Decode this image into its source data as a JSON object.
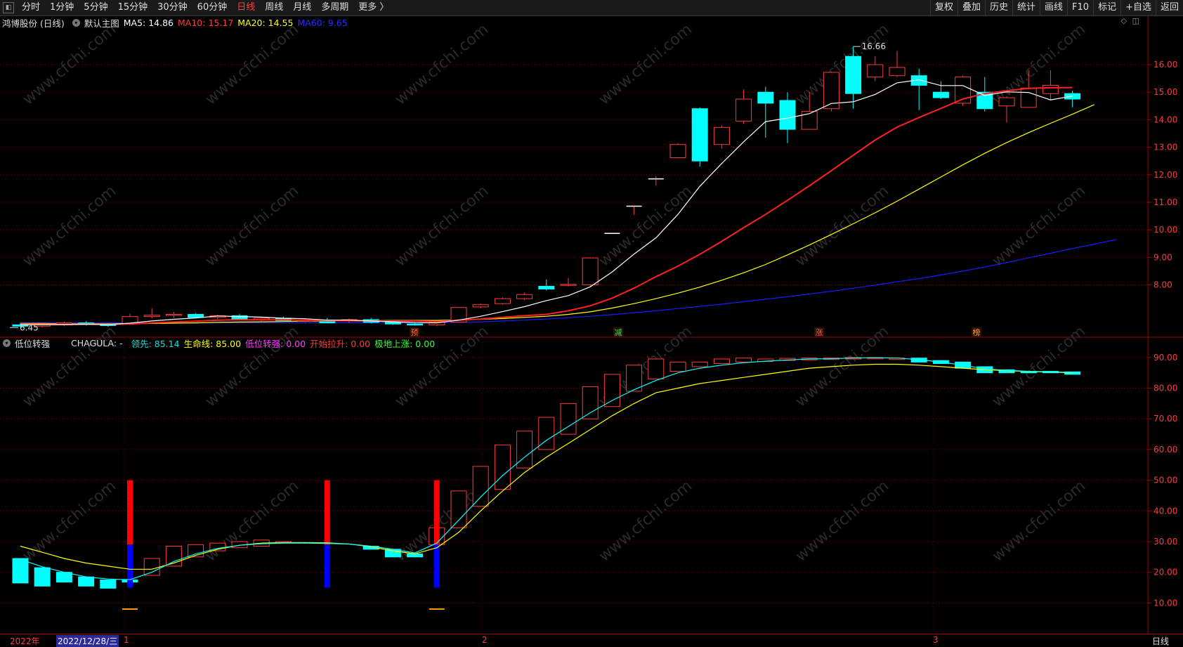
{
  "toolbar": {
    "collapse_glyph": "◧",
    "periods": [
      "分时",
      "1分钟",
      "5分钟",
      "15分钟",
      "30分钟",
      "60分钟",
      "日线",
      "周线",
      "月线",
      "多周期",
      "更多 〉"
    ],
    "active_period_index": 6,
    "right_buttons": [
      "复权",
      "叠加",
      "历史",
      "统计",
      "画线",
      "F10",
      "标记",
      "+自选",
      "返回"
    ]
  },
  "main_info": {
    "stock": "鸿博股份 (日线)",
    "template": "默认主图",
    "ma5": "MA5: 14.86",
    "ma10": "MA10: 15.17",
    "ma20": "MA20: 14.55",
    "ma60": "MA60: 9.65"
  },
  "sub_info": {
    "indicator": "低位转强",
    "formula": "CHAGULA: -",
    "lead": "领先: 85.14",
    "life": "生命线: 85.00",
    "low_strong": "低位转强: 0.00",
    "start_up": "开始拉升: 0.00",
    "bottom_rise": "极地上涨: 0.00"
  },
  "annotations": {
    "high_label": "16.66",
    "low_label": "6.45"
  },
  "markers": [
    {
      "label": "预",
      "color": "#ff6a3a"
    },
    {
      "label": "减",
      "color": "#2fdc5a"
    },
    {
      "label": "涨",
      "color": "#ff5555"
    },
    {
      "label": "榜",
      "color": "#ff9a3a"
    }
  ],
  "price_axis": {
    "ticks": [
      "16.00",
      "15.00",
      "14.00",
      "13.00",
      "12.00",
      "11.00",
      "10.00",
      "9.00",
      "8.00"
    ]
  },
  "sub_axis": {
    "ticks": [
      "90.00",
      "80.00",
      "70.00",
      "60.00",
      "50.00",
      "40.00",
      "30.00",
      "20.00",
      "10.00"
    ]
  },
  "bottom": {
    "year": "2022年",
    "date": "2022/12/28/三",
    "m1": "1",
    "m2": "2",
    "m3": "3",
    "period": "日线"
  },
  "colors": {
    "up": "#ff3b3b",
    "down": "#00ffff",
    "ma5": "#ffffff",
    "ma10": "#ff2020",
    "ma20": "#ffff00",
    "ma60": "#1a1aff",
    "lead": "#00ffff",
    "life": "#ffff00",
    "grid": "#6a0000"
  },
  "chart_data": {
    "type": "candlestick",
    "candles": [
      {
        "o": 6.55,
        "h": 6.62,
        "l": 6.48,
        "c": 6.5
      },
      {
        "o": 6.5,
        "h": 6.58,
        "l": 6.45,
        "c": 6.55
      },
      {
        "o": 6.55,
        "h": 6.66,
        "l": 6.5,
        "c": 6.62
      },
      {
        "o": 6.62,
        "h": 6.68,
        "l": 6.52,
        "c": 6.56
      },
      {
        "o": 6.56,
        "h": 6.62,
        "l": 6.48,
        "c": 6.52
      },
      {
        "o": 6.6,
        "h": 6.95,
        "l": 6.55,
        "c": 6.85
      },
      {
        "o": 6.85,
        "h": 7.15,
        "l": 6.78,
        "c": 6.9
      },
      {
        "o": 6.9,
        "h": 7.02,
        "l": 6.8,
        "c": 6.93
      },
      {
        "o": 6.93,
        "h": 6.98,
        "l": 6.8,
        "c": 6.82
      },
      {
        "o": 6.82,
        "h": 6.92,
        "l": 6.76,
        "c": 6.88
      },
      {
        "o": 6.88,
        "h": 6.94,
        "l": 6.72,
        "c": 6.74
      },
      {
        "o": 6.74,
        "h": 6.82,
        "l": 6.66,
        "c": 6.79
      },
      {
        "o": 6.79,
        "h": 6.85,
        "l": 6.67,
        "c": 6.7
      },
      {
        "o": 6.7,
        "h": 6.78,
        "l": 6.64,
        "c": 6.72
      },
      {
        "o": 6.72,
        "h": 6.8,
        "l": 6.6,
        "c": 6.62
      },
      {
        "o": 6.7,
        "h": 6.78,
        "l": 6.62,
        "c": 6.74
      },
      {
        "o": 6.74,
        "h": 6.8,
        "l": 6.6,
        "c": 6.64
      },
      {
        "o": 6.64,
        "h": 6.7,
        "l": 6.55,
        "c": 6.58
      },
      {
        "o": 6.58,
        "h": 6.64,
        "l": 6.52,
        "c": 6.55
      },
      {
        "o": 6.55,
        "h": 6.7,
        "l": 6.5,
        "c": 6.64
      },
      {
        "o": 6.65,
        "h": 7.2,
        "l": 6.65,
        "c": 7.18
      },
      {
        "o": 7.2,
        "h": 7.32,
        "l": 7.15,
        "c": 7.28
      },
      {
        "o": 7.32,
        "h": 7.55,
        "l": 7.28,
        "c": 7.5
      },
      {
        "o": 7.5,
        "h": 7.72,
        "l": 7.45,
        "c": 7.65
      },
      {
        "o": 7.95,
        "h": 8.2,
        "l": 7.8,
        "c": 7.85
      },
      {
        "o": 8.0,
        "h": 8.25,
        "l": 7.95,
        "c": 8.02
      },
      {
        "o": 8.0,
        "h": 9.0,
        "l": 7.95,
        "c": 8.98
      },
      {
        "o": 9.87,
        "h": 9.87,
        "l": 9.87,
        "c": 9.87
      },
      {
        "o": 10.86,
        "h": 10.86,
        "l": 10.55,
        "c": 10.86
      },
      {
        "o": 11.85,
        "h": 11.95,
        "l": 11.6,
        "c": 11.85
      },
      {
        "o": 12.62,
        "h": 13.15,
        "l": 12.62,
        "c": 13.1
      },
      {
        "o": 14.4,
        "h": 14.45,
        "l": 12.3,
        "c": 12.5
      },
      {
        "o": 13.1,
        "h": 13.8,
        "l": 12.95,
        "c": 13.72
      },
      {
        "o": 13.95,
        "h": 15.1,
        "l": 13.85,
        "c": 14.75
      },
      {
        "o": 15.0,
        "h": 15.2,
        "l": 13.35,
        "c": 14.6
      },
      {
        "o": 14.7,
        "h": 15.0,
        "l": 13.15,
        "c": 13.65
      },
      {
        "o": 13.65,
        "h": 15.0,
        "l": 13.65,
        "c": 14.3
      },
      {
        "o": 14.4,
        "h": 15.75,
        "l": 14.3,
        "c": 15.72
      },
      {
        "o": 16.3,
        "h": 16.66,
        "l": 14.4,
        "c": 14.95
      },
      {
        "o": 15.55,
        "h": 16.3,
        "l": 15.4,
        "c": 16.0
      },
      {
        "o": 15.6,
        "h": 16.5,
        "l": 15.55,
        "c": 15.9
      },
      {
        "o": 15.6,
        "h": 15.85,
        "l": 14.35,
        "c": 15.25
      },
      {
        "o": 15.0,
        "h": 15.4,
        "l": 14.75,
        "c": 14.8
      },
      {
        "o": 14.6,
        "h": 15.6,
        "l": 14.5,
        "c": 15.55
      },
      {
        "o": 15.0,
        "h": 15.55,
        "l": 14.3,
        "c": 14.4
      },
      {
        "o": 14.5,
        "h": 14.85,
        "l": 13.9,
        "c": 14.8
      },
      {
        "o": 14.45,
        "h": 15.8,
        "l": 14.45,
        "c": 15.15
      },
      {
        "o": 14.95,
        "h": 15.8,
        "l": 14.7,
        "c": 15.25
      },
      {
        "o": 14.95,
        "h": 15.05,
        "l": 14.45,
        "c": 14.75
      }
    ],
    "ma5": [
      6.56,
      6.55,
      6.56,
      6.57,
      6.56,
      6.61,
      6.69,
      6.75,
      6.8,
      6.87,
      6.85,
      6.83,
      6.79,
      6.77,
      6.72,
      6.72,
      6.69,
      6.66,
      6.63,
      6.62,
      6.72,
      6.86,
      7.03,
      7.21,
      7.43,
      7.61,
      7.93,
      8.47,
      9.12,
      9.71,
      10.56,
      11.58,
      12.41,
      13.2,
      13.93,
      14.06,
      14.22,
      14.59,
      14.65,
      14.92,
      15.34,
      15.45,
      15.24,
      15.24,
      14.88,
      15.01,
      14.99,
      14.72,
      14.86
    ],
    "ma10": [
      6.58,
      6.57,
      6.57,
      6.57,
      6.57,
      6.58,
      6.62,
      6.65,
      6.68,
      6.72,
      6.73,
      6.73,
      6.73,
      6.72,
      6.7,
      6.7,
      6.69,
      6.69,
      6.69,
      6.67,
      6.72,
      6.76,
      6.82,
      6.88,
      6.93,
      7.06,
      7.24,
      7.52,
      7.88,
      8.3,
      8.68,
      9.11,
      9.58,
      10.08,
      10.56,
      11.07,
      11.6,
      12.15,
      12.71,
      13.26,
      13.73,
      14.08,
      14.41,
      14.75,
      14.95,
      15.05,
      15.14,
      15.16,
      15.17
    ],
    "ma20": [
      6.6,
      6.6,
      6.59,
      6.59,
      6.59,
      6.59,
      6.6,
      6.61,
      6.62,
      6.64,
      6.65,
      6.66,
      6.67,
      6.68,
      6.69,
      6.7,
      6.7,
      6.71,
      6.71,
      6.71,
      6.73,
      6.75,
      6.78,
      6.82,
      6.86,
      6.93,
      7.02,
      7.16,
      7.32,
      7.5,
      7.7,
      7.92,
      8.17,
      8.44,
      8.74,
      9.09,
      9.45,
      9.83,
      10.22,
      10.62,
      11.04,
      11.48,
      11.92,
      12.36,
      12.78,
      13.17,
      13.53,
      13.87,
      14.2,
      14.55
    ],
    "ma60": [
      6.62,
      6.62,
      6.62,
      6.62,
      6.62,
      6.62,
      6.62,
      6.62,
      6.62,
      6.62,
      6.62,
      6.62,
      6.62,
      6.62,
      6.62,
      6.62,
      6.62,
      6.62,
      6.62,
      6.62,
      6.64,
      6.66,
      6.69,
      6.72,
      6.76,
      6.81,
      6.86,
      6.92,
      6.99,
      7.06,
      7.14,
      7.22,
      7.3,
      7.39,
      7.48,
      7.57,
      7.67,
      7.77,
      7.88,
      7.99,
      8.11,
      8.23,
      8.36,
      8.5,
      8.65,
      8.81,
      8.98,
      9.15,
      9.32,
      9.48,
      9.65
    ],
    "y_range": [
      6.1,
      17.2
    ],
    "sub": {
      "y_range": [
        0,
        95
      ],
      "boxes": [
        {
          "i": 0,
          "a": 24.5,
          "b": 16.5,
          "up": false
        },
        {
          "i": 1,
          "a": 21.5,
          "b": 15.5,
          "up": false
        },
        {
          "i": 2,
          "a": 20.0,
          "b": 16.8,
          "up": false
        },
        {
          "i": 3,
          "a": 18.5,
          "b": 15.5,
          "up": false
        },
        {
          "i": 4,
          "a": 17.5,
          "b": 14.8,
          "up": false
        },
        {
          "i": 5,
          "a": 17.5,
          "b": 16.8,
          "up": false
        },
        {
          "i": 6,
          "a": 19.0,
          "b": 24.5,
          "up": true
        },
        {
          "i": 7,
          "a": 22.0,
          "b": 28.5,
          "up": true
        },
        {
          "i": 8,
          "a": 25.0,
          "b": 29.0,
          "up": true
        },
        {
          "i": 9,
          "a": 27.0,
          "b": 29.5,
          "up": true
        },
        {
          "i": 10,
          "a": 28.0,
          "b": 30.0,
          "up": true
        },
        {
          "i": 11,
          "a": 28.5,
          "b": 30.5,
          "up": true
        },
        {
          "i": 12,
          "a": 29.5,
          "b": 30.0,
          "up": true
        },
        {
          "i": 16,
          "a": 28.5,
          "b": 27.5,
          "up": false
        },
        {
          "i": 17,
          "a": 27.5,
          "b": 25.0,
          "up": false
        },
        {
          "i": 18,
          "a": 26.0,
          "b": 25.0,
          "up": false
        },
        {
          "i": 19,
          "a": 29.0,
          "b": 34.5,
          "up": true
        },
        {
          "i": 20,
          "a": 34.5,
          "b": 46.5,
          "up": true
        },
        {
          "i": 21,
          "a": 41.5,
          "b": 54.5,
          "up": true
        },
        {
          "i": 22,
          "a": 47.0,
          "b": 61.5,
          "up": true
        },
        {
          "i": 23,
          "a": 54.0,
          "b": 66.0,
          "up": true
        },
        {
          "i": 24,
          "a": 60.0,
          "b": 70.5,
          "up": true
        },
        {
          "i": 25,
          "a": 65.0,
          "b": 75.0,
          "up": true
        },
        {
          "i": 26,
          "a": 70.0,
          "b": 80.5,
          "up": true
        },
        {
          "i": 27,
          "a": 74.0,
          "b": 84.5,
          "up": true
        },
        {
          "i": 28,
          "a": 79.0,
          "b": 87.5,
          "up": true
        },
        {
          "i": 29,
          "a": 83.0,
          "b": 89.5,
          "up": true
        },
        {
          "i": 30,
          "a": 85.5,
          "b": 88.5,
          "up": true
        },
        {
          "i": 31,
          "a": 87.0,
          "b": 88.5,
          "up": true
        },
        {
          "i": 32,
          "a": 88.0,
          "b": 89.5,
          "up": true
        },
        {
          "i": 33,
          "a": 88.5,
          "b": 89.8,
          "up": true
        },
        {
          "i": 34,
          "a": 88.7,
          "b": 89.5,
          "up": true
        },
        {
          "i": 35,
          "a": 89.0,
          "b": 89.7,
          "up": true
        },
        {
          "i": 36,
          "a": 89.2,
          "b": 89.8,
          "up": true
        },
        {
          "i": 37,
          "a": 89.4,
          "b": 89.8,
          "up": true
        },
        {
          "i": 38,
          "a": 89.5,
          "b": 90.0,
          "up": true
        },
        {
          "i": 39,
          "a": 89.7,
          "b": 90.0,
          "up": true
        },
        {
          "i": 40,
          "a": 89.6,
          "b": 89.8,
          "up": true
        },
        {
          "i": 41,
          "a": 89.8,
          "b": 88.5,
          "up": false
        },
        {
          "i": 42,
          "a": 89.0,
          "b": 88.0,
          "up": false
        },
        {
          "i": 43,
          "a": 88.5,
          "b": 86.5,
          "up": false
        },
        {
          "i": 44,
          "a": 87.0,
          "b": 85.0,
          "up": false
        },
        {
          "i": 45,
          "a": 86.0,
          "b": 85.0,
          "up": false
        },
        {
          "i": 46,
          "a": 85.5,
          "b": 85.0,
          "up": false
        },
        {
          "i": 47,
          "a": 85.5,
          "b": 85.0,
          "up": false
        },
        {
          "i": 48,
          "a": 85.3,
          "b": 84.5,
          "up": false
        }
      ],
      "lead": [
        24.2,
        21.8,
        20.0,
        18.5,
        17.8,
        17.6,
        20.0,
        23.5,
        26.0,
        27.8,
        28.8,
        29.3,
        29.5,
        29.5,
        29.4,
        29.2,
        28.5,
        27.5,
        26.3,
        29.5,
        37.0,
        44.5,
        51.5,
        57.5,
        63.0,
        67.5,
        72.0,
        76.0,
        79.5,
        82.5,
        85.0,
        86.5,
        87.5,
        88.3,
        88.8,
        89.2,
        89.5,
        89.6,
        89.8,
        89.9,
        89.8,
        89.3,
        88.5,
        87.5,
        86.3,
        85.8,
        85.5,
        85.3,
        85.1
      ],
      "life": [
        28.5,
        26.5,
        24.5,
        23.0,
        22.0,
        21.0,
        21.0,
        23.0,
        25.5,
        27.5,
        28.8,
        29.5,
        29.7,
        29.7,
        29.6,
        29.2,
        28.3,
        27.0,
        26.0,
        28.0,
        33.0,
        40.0,
        46.5,
        52.5,
        57.5,
        62.0,
        66.5,
        71.0,
        75.0,
        78.5,
        80.0,
        81.5,
        82.5,
        83.5,
        84.5,
        85.5,
        86.5,
        87.0,
        87.5,
        87.8,
        87.8,
        87.5,
        87.0,
        86.5,
        86.0,
        85.7,
        85.4,
        85.2,
        85.0
      ],
      "signals": [
        {
          "i": 5,
          "red_top": 50,
          "red_bot": 29,
          "blue_top": 29,
          "blue_bot": 15
        },
        {
          "i": 14,
          "red_top": 50,
          "red_bot": 29,
          "blue_top": 29,
          "blue_bot": 15
        },
        {
          "i": 19,
          "red_top": 50,
          "red_bot": 29,
          "blue_top": 29,
          "blue_bot": 15
        }
      ],
      "tiny_marks": [
        5,
        19
      ]
    }
  }
}
